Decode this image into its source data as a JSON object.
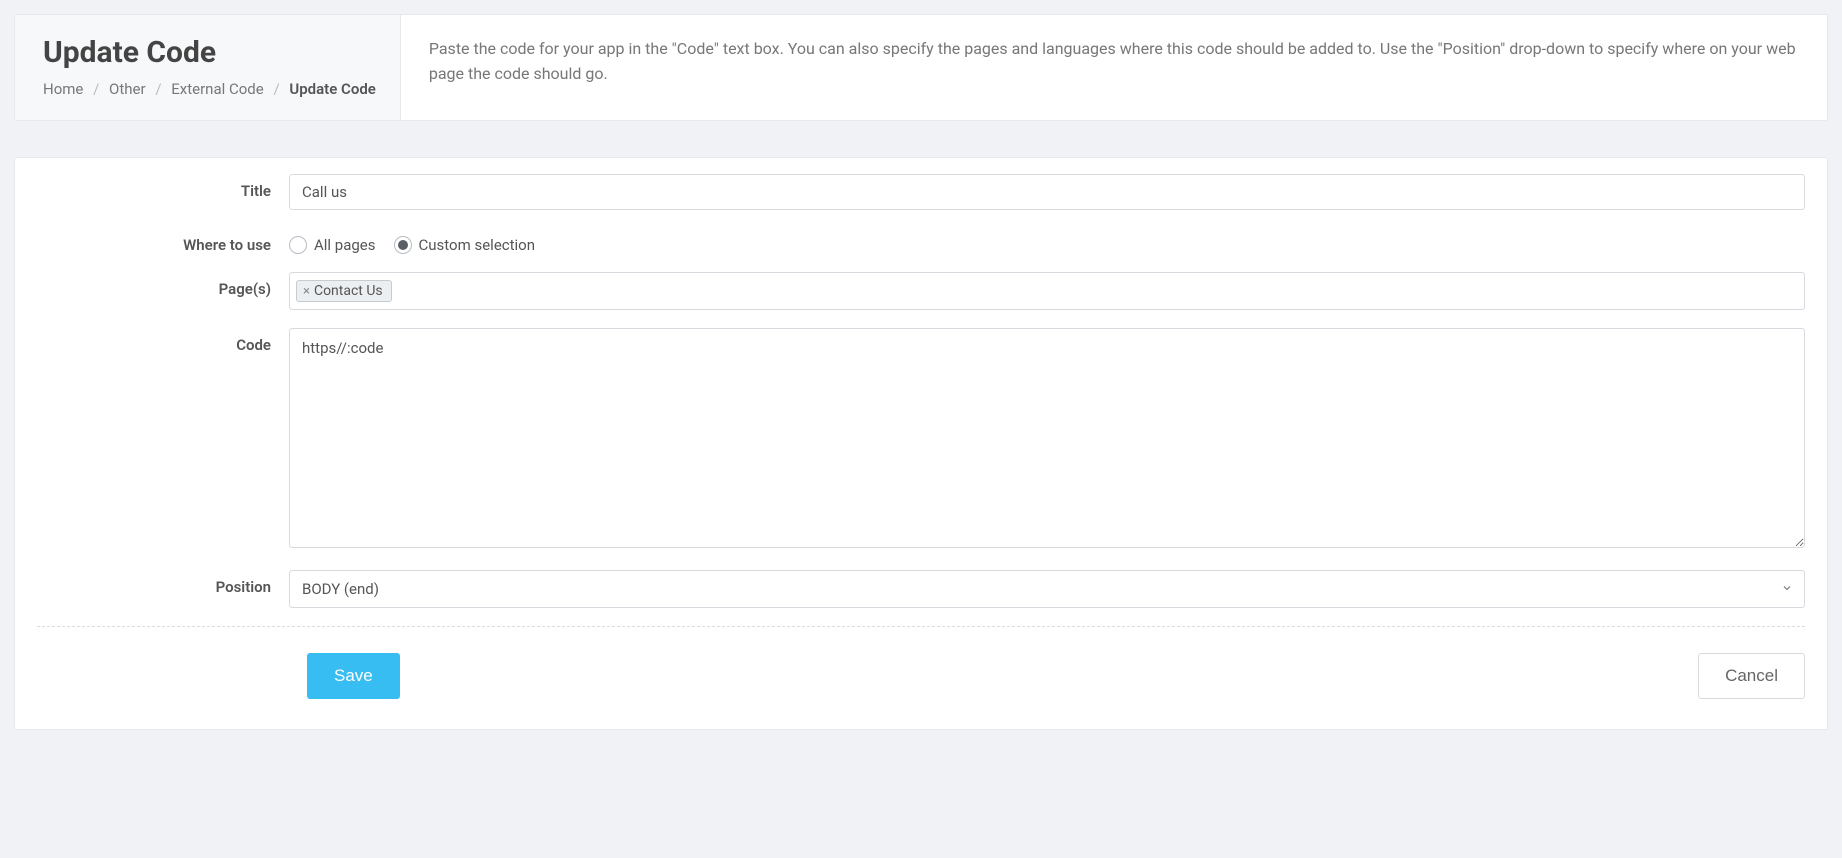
{
  "header": {
    "title": "Update Code",
    "breadcrumb": {
      "items": [
        "Home",
        "Other",
        "External Code"
      ],
      "current": "Update Code"
    },
    "description": "Paste the code for your app in the \"Code\" text box. You can also specify the pages and languages where this code should be added to. Use the \"Position\" drop-down to specify where on your web page the code should go."
  },
  "form": {
    "labels": {
      "title": "Title",
      "where": "Where to use",
      "pages": "Page(s)",
      "code": "Code",
      "position": "Position"
    },
    "title_value": "Call us",
    "where_options": {
      "all": "All pages",
      "custom": "Custom selection",
      "selected": "custom"
    },
    "pages_tags": [
      "Contact Us"
    ],
    "code_value": "https//:code",
    "position_value": "BODY (end)"
  },
  "buttons": {
    "save": "Save",
    "cancel": "Cancel"
  }
}
